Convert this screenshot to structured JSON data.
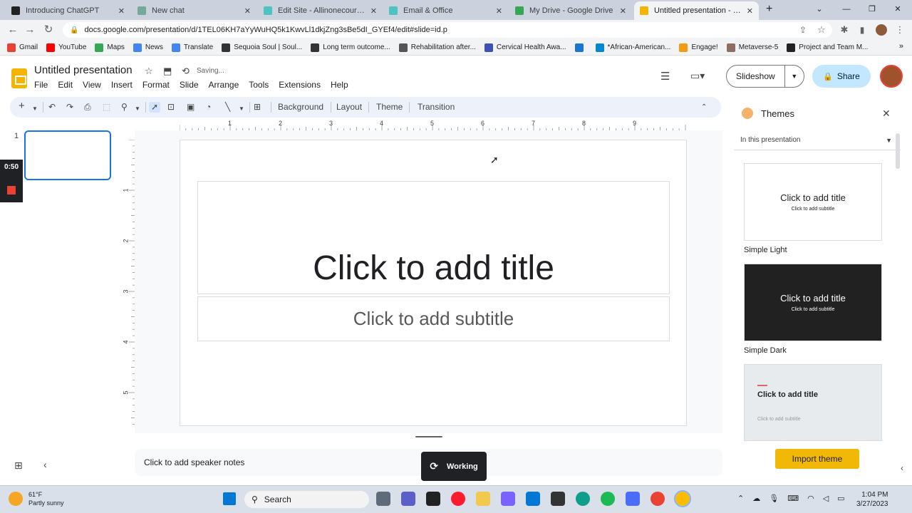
{
  "browser": {
    "tabs": [
      {
        "title": "Introducing ChatGPT",
        "color": "#222222",
        "active": false
      },
      {
        "title": "New chat",
        "color": "#74aa9c",
        "active": false
      },
      {
        "title": "Edit Site - Allinonecoursebuil",
        "color": "#4fc3c3",
        "active": false
      },
      {
        "title": "Email & Office",
        "color": "#4fc3c3",
        "active": false
      },
      {
        "title": "My Drive - Google Drive",
        "color": "#34a853",
        "active": false
      },
      {
        "title": "Untitled presentation - Goog",
        "color": "#f4b400",
        "active": true
      }
    ],
    "new_tab": "+",
    "url": "docs.google.com/presentation/d/1TEL06KH7aYyWuHQ5k1KwvLl1dkjZng3sBe5dI_GYEf4/edit#slide=id.p",
    "bookmarks": [
      {
        "label": "Gmail",
        "color": "#ea4335"
      },
      {
        "label": "YouTube",
        "color": "#ff0000"
      },
      {
        "label": "Maps",
        "color": "#34a853"
      },
      {
        "label": "News",
        "color": "#4285f4"
      },
      {
        "label": "Translate",
        "color": "#4285f4"
      },
      {
        "label": "Sequoia Soul | Soul...",
        "color": "#333333"
      },
      {
        "label": "Long term outcome...",
        "color": "#333333"
      },
      {
        "label": "Rehabilitation after...",
        "color": "#555555"
      },
      {
        "label": "Cervical Health Awa...",
        "color": "#3f51b5"
      },
      {
        "label": "",
        "color": "#1976d2"
      },
      {
        "label": "*African-American...",
        "color": "#0288d1"
      },
      {
        "label": "Engage!",
        "color": "#f39c12"
      },
      {
        "label": "Metaverse-5",
        "color": "#8d6e63"
      },
      {
        "label": "Project and Team M...",
        "color": "#222222"
      }
    ]
  },
  "docs": {
    "title": "Untitled presentation",
    "status": "Saving...",
    "menu": [
      "File",
      "Edit",
      "View",
      "Insert",
      "Format",
      "Slide",
      "Arrange",
      "Tools",
      "Extensions",
      "Help"
    ],
    "slideshow_label": "Slideshow",
    "share_label": "Share",
    "toolbar_text": [
      "Background",
      "Layout",
      "Theme",
      "Transition"
    ],
    "ruler_h": [
      "1",
      "2",
      "3",
      "4",
      "5",
      "6",
      "7",
      "8",
      "9"
    ],
    "ruler_v": [
      "1",
      "2",
      "3",
      "4",
      "5"
    ]
  },
  "filmstrip": {
    "slide_number": "1"
  },
  "recorder": {
    "time": "0:50"
  },
  "slide": {
    "title_placeholder": "Click to add title",
    "subtitle_placeholder": "Click to add subtitle"
  },
  "notes_placeholder": "Click to add speaker notes",
  "working_label": "Working",
  "themes_panel": {
    "heading": "Themes",
    "section": "In this presentation",
    "themes": [
      {
        "name": "Simple Light",
        "title": "Click to add title",
        "subtitle": "Click to add subtitle",
        "bg": "#ffffff",
        "fg": "#202124"
      },
      {
        "name": "Simple Dark",
        "title": "Click to add title",
        "subtitle": "Click to add subtitle",
        "bg": "#212121",
        "fg": "#ffffff"
      },
      {
        "name": "",
        "title": "Click to add title",
        "subtitle": "Click to add subtitle",
        "bg": "#e8ebed",
        "fg": "#202124"
      }
    ],
    "import_label": "Import theme"
  },
  "taskbar": {
    "weather_temp": "61°F",
    "weather_desc": "Partly sunny",
    "search_label": "Search",
    "time": "1:04 PM",
    "date": "3/27/2023"
  },
  "colors": {
    "accent": "#1a73e8",
    "share_bg": "#c2e7ff",
    "import_btn": "#f1b807"
  }
}
